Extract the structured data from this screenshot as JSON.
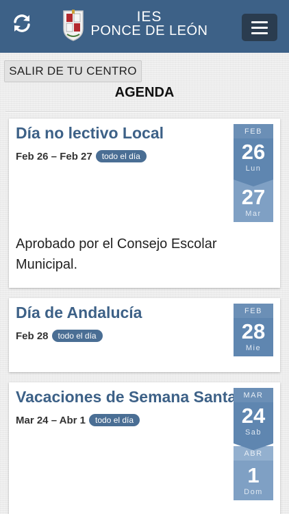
{
  "header": {
    "title_line1": "IES",
    "title_line2": "PONCE DE LEÓN",
    "refresh_icon": "refresh-icon",
    "menu_icon": "hamburger-menu-icon",
    "bg_color": "#3d6187"
  },
  "exit_button": "SALIR DE TU CENTRO",
  "page_title": "AGENDA",
  "events": [
    {
      "title": "Día no lectivo Local",
      "date_range": "Feb 26 – Feb 27",
      "all_day": "todo el día",
      "description": "Aprobado por el Consejo Escolar Municipal.",
      "cal_start": {
        "month": "FEB",
        "day": "26",
        "weekday": "Lun"
      },
      "cal_end": {
        "day": "27",
        "weekday": "Mar"
      }
    },
    {
      "title": "Día de Andalucía",
      "date_range": "Feb 28",
      "all_day": "todo el día",
      "cal_start": {
        "month": "FEB",
        "day": "28",
        "weekday": "Mie"
      }
    },
    {
      "title": "Vacaciones de Semana Santa",
      "date_range": "Mar 24 – Abr 1",
      "all_day": "todo el día",
      "cal_start": {
        "month": "MAR",
        "day": "24",
        "weekday": "Sab"
      },
      "cal_end": {
        "month": "ABR",
        "day": "1",
        "weekday": "Dom"
      }
    }
  ]
}
